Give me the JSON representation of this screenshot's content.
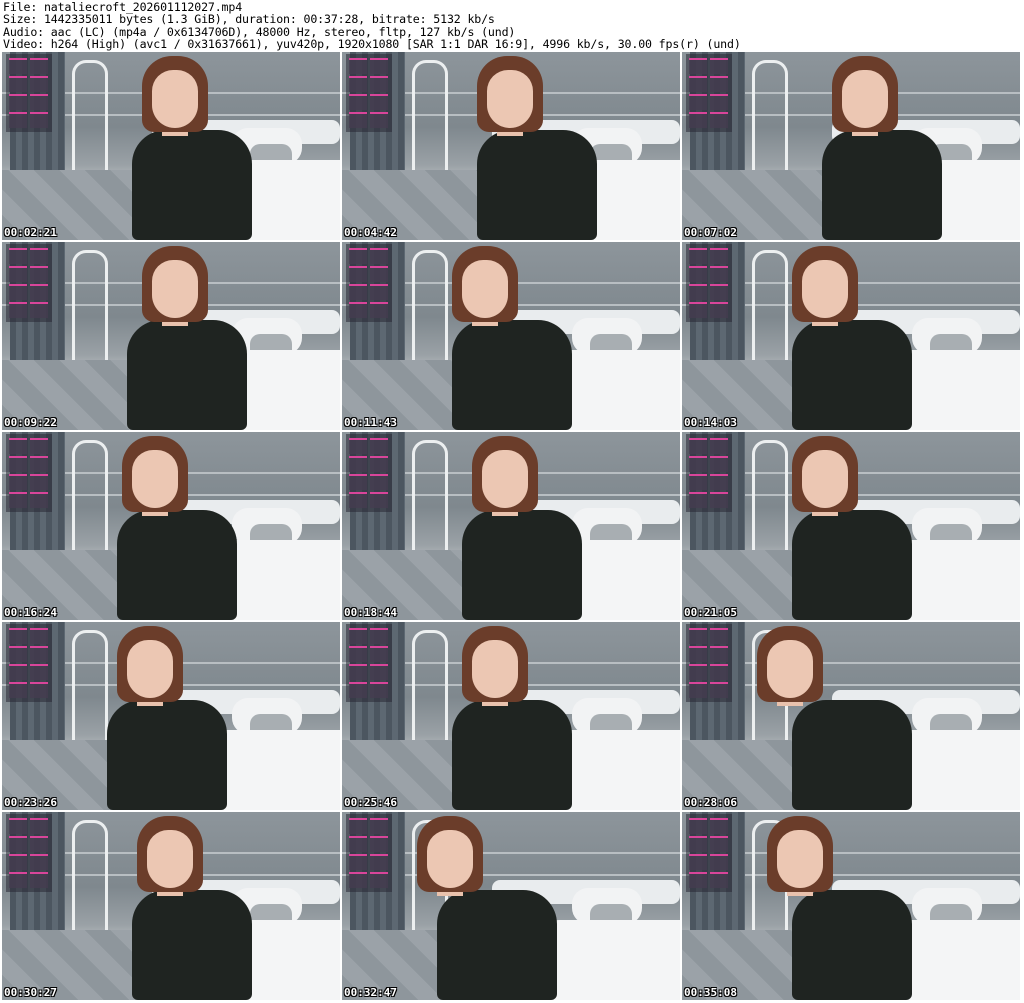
{
  "header": {
    "file": "File: nataliecroft_202601112027.mp4",
    "size": "Size: 1442335011 bytes (1.3 GiB), duration: 00:37:28, bitrate: 5132 kb/s",
    "audio": "Audio: aac (LC) (mp4a / 0x6134706D), 48000 Hz, stereo, fltp, 127 kb/s (und)",
    "video": "Video: h264 (High) (avc1 / 0x31637661), yuv420p, 1920x1080 [SAR 1:1 DAR 16:9], 4996 kb/s, 30.00 fps(r) (und)"
  },
  "thumbnails": [
    {
      "timestamp": "00:02:21"
    },
    {
      "timestamp": "00:04:42"
    },
    {
      "timestamp": "00:07:02"
    },
    {
      "timestamp": "00:09:22"
    },
    {
      "timestamp": "00:11:43"
    },
    {
      "timestamp": "00:14:03"
    },
    {
      "timestamp": "00:16:24"
    },
    {
      "timestamp": "00:18:44"
    },
    {
      "timestamp": "00:21:05"
    },
    {
      "timestamp": "00:23:26"
    },
    {
      "timestamp": "00:25:46"
    },
    {
      "timestamp": "00:28:06"
    },
    {
      "timestamp": "00:30:27"
    },
    {
      "timestamp": "00:32:47"
    },
    {
      "timestamp": "00:35:08"
    }
  ],
  "colors": {
    "overlay_accent": "#d8459a",
    "shirt": "#1f2421",
    "hair": "#6b3d2a"
  }
}
